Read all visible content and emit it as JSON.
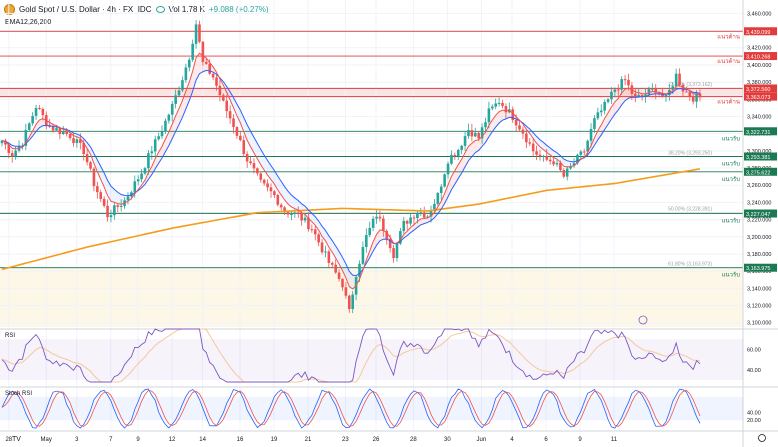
{
  "header": {
    "title": "Gold Spot / U.S. Dollar · 4h · FX_IDC",
    "volume": "Vol 1.78 K",
    "change": "+9.088 (+0.27%)",
    "ema_label": "EMA12,26,200"
  },
  "colors": {
    "up": "#26a69a",
    "down": "#ef5350",
    "ema12": "#ef5350",
    "ema26": "#2962ff",
    "ema200": "#f59c1a",
    "resistance": "#e23b3b",
    "support": "#1b7a52",
    "fib": "#9e9e9e",
    "rsi": "#7e57c2",
    "rsi_ma": "#f5c89b",
    "stoch_k": "#2962ff",
    "stoch_d": "#ef5350"
  },
  "chart_data": {
    "type": "candlestick",
    "x_ticks": [
      "28",
      "May",
      "3",
      "7",
      "9",
      "12",
      "14",
      "16",
      "19",
      "21",
      "23",
      "26",
      "28",
      "30",
      "Jun",
      "4",
      "6",
      "9",
      "11"
    ],
    "y_ticks": [
      "3,460.000",
      "3,440.000",
      "3,420.000",
      "3,400.000",
      "3,380.000",
      "3,360.000",
      "3,340.000",
      "3,320.000",
      "3,300.000",
      "3,280.000",
      "3,260.000",
      "3,240.000",
      "3,220.000",
      "3,200.000",
      "3,180.000",
      "3,160.000",
      "3,140.000",
      "3,120.000",
      "3,100.000"
    ],
    "ylim": [
      3095,
      3472
    ],
    "levels": [
      {
        "value": 3439.099,
        "label": "3,439.099",
        "kind": "resistance",
        "tag": "แนวต้าน"
      },
      {
        "value": 3410.268,
        "label": "3,410.268",
        "kind": "resistance",
        "tag": "แนวต้าน"
      },
      {
        "value": 3372.56,
        "label": "3,372.560",
        "kind": "resistance",
        "tag": ""
      },
      {
        "value": 3363.073,
        "label": "3,363.073",
        "kind": "resistance",
        "tag": "แนวต้าน"
      },
      {
        "value": 3322.731,
        "label": "3,322.731",
        "kind": "support",
        "tag": "แนวรับ"
      },
      {
        "value": 3293.381,
        "label": "3,293.381",
        "kind": "support",
        "tag": "แนวรับ"
      },
      {
        "value": 3275.622,
        "label": "3,275.622",
        "kind": "support",
        "tag": "แนวรับ"
      },
      {
        "value": 3227.047,
        "label": "3,227.047",
        "kind": "support",
        "tag": "แนวรับ"
      },
      {
        "value": 3163.975,
        "label": "3,163.975",
        "kind": "support",
        "tag": "แนวรับ"
      }
    ],
    "fib": [
      {
        "value": 3373.162,
        "text": "23.60% (3,373.162)"
      },
      {
        "value": 3293.25,
        "text": "38.20% (3,293.250)"
      },
      {
        "value": 3228.391,
        "text": "50.00% (3,228.391)"
      },
      {
        "value": 3163.973,
        "text": "61.80% (3,163.973)"
      }
    ],
    "path": [
      [
        0,
        3312
      ],
      [
        3,
        3296
      ],
      [
        6,
        3310
      ],
      [
        10,
        3352
      ],
      [
        14,
        3328
      ],
      [
        20,
        3318
      ],
      [
        24,
        3300
      ],
      [
        27,
        3262
      ],
      [
        31,
        3225
      ],
      [
        36,
        3242
      ],
      [
        41,
        3275
      ],
      [
        44,
        3302
      ],
      [
        47,
        3325
      ],
      [
        50,
        3352
      ],
      [
        53,
        3385
      ],
      [
        55,
        3410
      ],
      [
        57,
        3448
      ],
      [
        59,
        3402
      ],
      [
        62,
        3386
      ],
      [
        65,
        3355
      ],
      [
        68,
        3330
      ],
      [
        72,
        3290
      ],
      [
        76,
        3262
      ],
      [
        80,
        3248
      ],
      [
        83,
        3230
      ],
      [
        87,
        3225
      ],
      [
        91,
        3210
      ],
      [
        96,
        3170
      ],
      [
        100,
        3145
      ],
      [
        102,
        3112
      ],
      [
        104,
        3158
      ],
      [
        107,
        3200
      ],
      [
        110,
        3226
      ],
      [
        113,
        3202
      ],
      [
        115,
        3180
      ],
      [
        118,
        3215
      ],
      [
        122,
        3230
      ],
      [
        125,
        3225
      ],
      [
        128,
        3248
      ],
      [
        131,
        3290
      ],
      [
        134,
        3302
      ],
      [
        137,
        3325
      ],
      [
        140,
        3315
      ],
      [
        143,
        3345
      ],
      [
        146,
        3358
      ],
      [
        150,
        3340
      ],
      [
        153,
        3322
      ],
      [
        156,
        3300
      ],
      [
        159,
        3290
      ],
      [
        162,
        3288
      ],
      [
        165,
        3270
      ],
      [
        168,
        3286
      ],
      [
        171,
        3300
      ],
      [
        174,
        3335
      ],
      [
        177,
        3352
      ],
      [
        180,
        3372
      ],
      [
        183,
        3382
      ],
      [
        186,
        3360
      ],
      [
        189,
        3366
      ],
      [
        192,
        3372
      ],
      [
        195,
        3360
      ],
      [
        198,
        3388
      ],
      [
        200,
        3372
      ],
      [
        203,
        3362
      ],
      [
        205,
        3362
      ]
    ],
    "ema200_path": [
      [
        0,
        3162
      ],
      [
        25,
        3188
      ],
      [
        50,
        3210
      ],
      [
        75,
        3228
      ],
      [
        100,
        3233
      ],
      [
        125,
        3230
      ],
      [
        140,
        3238
      ],
      [
        160,
        3254
      ],
      [
        180,
        3262
      ],
      [
        205,
        3279
      ]
    ],
    "rsi": {
      "label": "RSI",
      "ylim": [
        28,
        80
      ],
      "ticks": [
        "60.00",
        "40.00"
      ],
      "bands": [
        70,
        30
      ]
    },
    "stoch": {
      "label": "Stoch RSI",
      "ylim": [
        -5,
        105
      ],
      "ticks": [
        "40.00",
        "20.00"
      ],
      "bands": [
        80,
        20
      ]
    }
  }
}
